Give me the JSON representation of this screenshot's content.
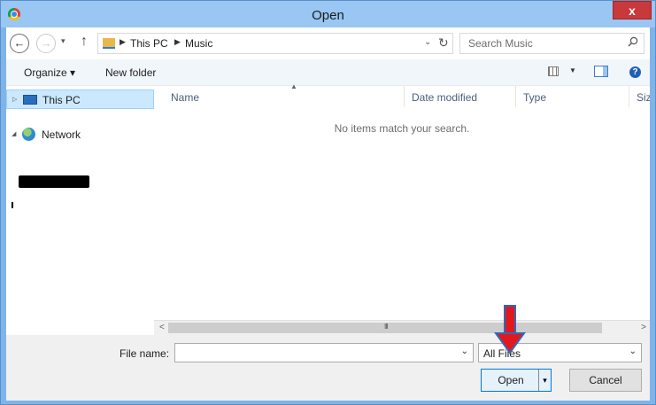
{
  "window": {
    "title": "Open",
    "close_label": "x"
  },
  "address_bar": {
    "back_label": "←",
    "forward_label": "→",
    "recent_label": "▾",
    "up_label": "↑",
    "breadcrumbs": [
      "This PC",
      "Music"
    ],
    "dropdown_label": "⌄",
    "refresh_label": "↻"
  },
  "search": {
    "placeholder": "Search Music"
  },
  "command_bar": {
    "organize_label": "Organize ▾",
    "new_folder_label": "New folder",
    "help_label": "?"
  },
  "nav_pane": {
    "items": [
      {
        "label": "This PC",
        "icon": "computer-icon",
        "expanded": false,
        "selected": true
      },
      {
        "label": "Network",
        "icon": "network-icon",
        "expanded": true,
        "selected": false
      }
    ]
  },
  "file_list": {
    "columns": [
      "Name",
      "Date modified",
      "Type",
      "Size"
    ],
    "sorted_column": "Name",
    "empty_message": "No items match your search."
  },
  "scrollbar": {
    "left_label": "<",
    "right_label": ">",
    "grip_label": "III"
  },
  "footer": {
    "file_name_label": "File name:",
    "file_name_value": "",
    "file_type_value": "All Files",
    "open_label": "Open",
    "open_split_label": "▾",
    "cancel_label": "Cancel"
  },
  "colors": {
    "title_bar": "#99c6f3",
    "close_button": "#c7393a",
    "selection": "#cce8ff",
    "annotation_arrow": "#e0191f",
    "annotation_arrow_outline": "#3567b5"
  }
}
